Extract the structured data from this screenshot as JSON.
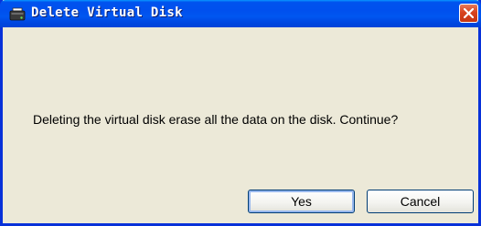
{
  "window": {
    "title": "Delete Virtual Disk",
    "title_icon": "virtual-disk-icon",
    "close_icon": "close-icon"
  },
  "dialog": {
    "message": "Deleting the virtual disk erase all the data on the disk. Continue?",
    "buttons": {
      "yes_label": "Yes",
      "cancel_label": "Cancel"
    }
  },
  "colors": {
    "titlebar": "#0054e3",
    "body": "#ece9d8",
    "close_button": "#d8431e",
    "button_border": "#003c74"
  }
}
